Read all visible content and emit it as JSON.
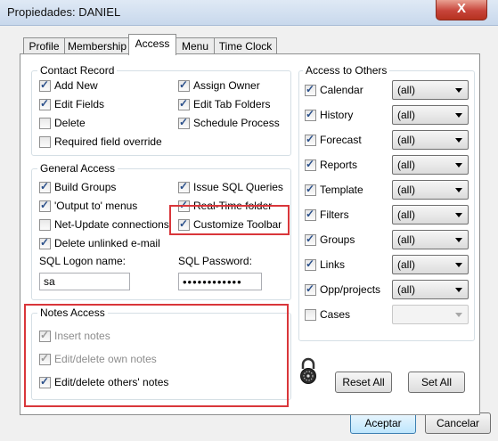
{
  "window": {
    "title": "Propiedades: DANIEL",
    "close_glyph": "X"
  },
  "tabs": [
    {
      "label": "Profile"
    },
    {
      "label": "Membership"
    },
    {
      "label": "Access",
      "active": true
    },
    {
      "label": "Menu"
    },
    {
      "label": "Time Clock"
    }
  ],
  "contact_record": {
    "title": "Contact Record",
    "items": {
      "add_new": {
        "label": "Add New",
        "checked": true
      },
      "assign_owner": {
        "label": "Assign Owner",
        "checked": true
      },
      "edit_fields": {
        "label": "Edit Fields",
        "checked": true
      },
      "edit_tab_folders": {
        "label": "Edit Tab Folders",
        "checked": true
      },
      "delete": {
        "label": "Delete",
        "checked": false
      },
      "schedule_process": {
        "label": "Schedule Process",
        "checked": true
      },
      "required_field_override": {
        "label": "Required field override",
        "checked": false
      }
    }
  },
  "general_access": {
    "title": "General Access",
    "items": {
      "build_groups": {
        "label": "Build Groups",
        "checked": true
      },
      "issue_sql_queries": {
        "label": "Issue SQL Queries",
        "checked": true
      },
      "output_to_menus": {
        "label": "'Output to' menus",
        "checked": true
      },
      "realtime_folder": {
        "label": "Real-Time folder",
        "checked": true
      },
      "net_update": {
        "label": "Net-Update connections",
        "checked": false
      },
      "customize_toolbar": {
        "label": "Customize Toolbar",
        "checked": true
      },
      "delete_unlinked_email": {
        "label": "Delete unlinked e-mail",
        "checked": true
      }
    },
    "sql_logon_label": "SQL Logon name:",
    "sql_logon_value": "sa",
    "sql_password_label": "SQL Password:",
    "sql_password_value": "••••••••••••"
  },
  "notes_access": {
    "title": "Notes Access",
    "items": {
      "insert_notes": {
        "label": "Insert notes",
        "checked": true,
        "disabled": true
      },
      "edit_delete_own": {
        "label": "Edit/delete own notes",
        "checked": true,
        "disabled": true
      },
      "edit_delete_others": {
        "label": "Edit/delete others' notes",
        "checked": true,
        "disabled": false
      }
    }
  },
  "access_to_others": {
    "title": "Access to Others",
    "rows": [
      {
        "label": "Calendar",
        "checked": true,
        "value": "(all)"
      },
      {
        "label": "History",
        "checked": true,
        "value": "(all)"
      },
      {
        "label": "Forecast",
        "checked": true,
        "value": "(all)"
      },
      {
        "label": "Reports",
        "checked": true,
        "value": "(all)"
      },
      {
        "label": "Template",
        "checked": true,
        "value": "(all)"
      },
      {
        "label": "Filters",
        "checked": true,
        "value": "(all)"
      },
      {
        "label": "Groups",
        "checked": true,
        "value": "(all)"
      },
      {
        "label": "Links",
        "checked": true,
        "value": "(all)"
      },
      {
        "label": "Opp/projects",
        "checked": true,
        "value": "(all)"
      },
      {
        "label": "Cases",
        "checked": false,
        "value": "",
        "disabled": true
      }
    ]
  },
  "icons": {
    "lock": "padlock-icon"
  },
  "buttons": {
    "reset_all": "Reset All",
    "set_all": "Set All",
    "accept": "Aceptar",
    "cancel": "Cancelar"
  },
  "colors": {
    "highlight": "#d9363a",
    "check": "#2a4f8a"
  }
}
